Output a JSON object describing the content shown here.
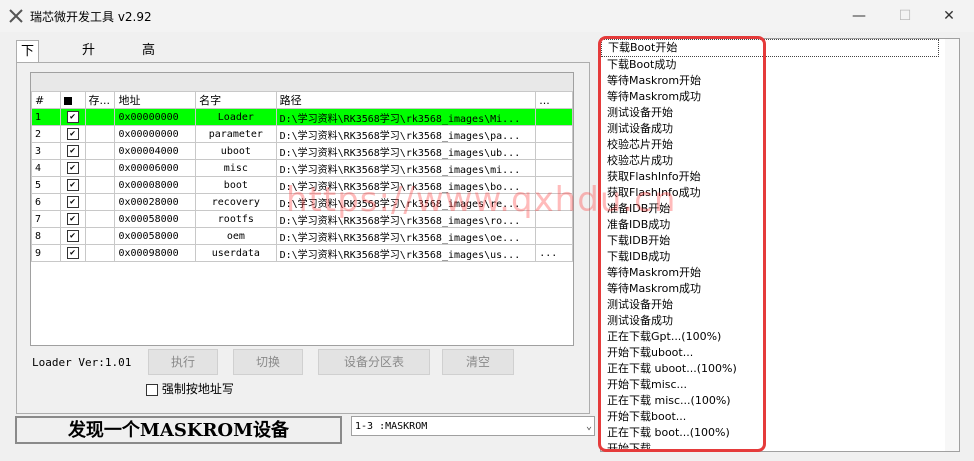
{
  "window": {
    "title": "瑞芯微开发工具 v2.92",
    "minimize": "—",
    "maximize": "☐",
    "close": "✕"
  },
  "tabs": [
    "下载镜像",
    "升级固件",
    "高级功能"
  ],
  "grid": {
    "headers": [
      "#",
      "",
      "存...",
      "地址",
      "名字",
      "路径",
      "..."
    ],
    "rows": [
      {
        "idx": "1",
        "checked": true,
        "addr": "0x00000000",
        "name": "Loader",
        "path": "D:\\学习资料\\RK3568学习\\rk3568_images\\Mi...",
        "more": "",
        "selected": true
      },
      {
        "idx": "2",
        "checked": true,
        "addr": "0x00000000",
        "name": "parameter",
        "path": "D:\\学习资料\\RK3568学习\\rk3568_images\\pa...",
        "more": ""
      },
      {
        "idx": "3",
        "checked": true,
        "addr": "0x00004000",
        "name": "uboot",
        "path": "D:\\学习资料\\RK3568学习\\rk3568_images\\ub...",
        "more": ""
      },
      {
        "idx": "4",
        "checked": true,
        "addr": "0x00006000",
        "name": "misc",
        "path": "D:\\学习资料\\RK3568学习\\rk3568_images\\mi...",
        "more": ""
      },
      {
        "idx": "5",
        "checked": true,
        "addr": "0x00008000",
        "name": "boot",
        "path": "D:\\学习资料\\RK3568学习\\rk3568_images\\bo...",
        "more": ""
      },
      {
        "idx": "6",
        "checked": true,
        "addr": "0x00028000",
        "name": "recovery",
        "path": "D:\\学习资料\\RK3568学习\\rk3568_images\\re...",
        "more": ""
      },
      {
        "idx": "7",
        "checked": true,
        "addr": "0x00058000",
        "name": "rootfs",
        "path": "D:\\学习资料\\RK3568学习\\rk3568_images\\ro...",
        "more": ""
      },
      {
        "idx": "8",
        "checked": true,
        "addr": "0x00058000",
        "name": "oem",
        "path": "D:\\学习资料\\RK3568学习\\rk3568_images\\oe...",
        "more": ""
      },
      {
        "idx": "9",
        "checked": true,
        "addr": "0x00098000",
        "name": "userdata",
        "path": "D:\\学习资料\\RK3568学习\\rk3568_images\\us...",
        "more": "..."
      }
    ]
  },
  "loader_version": "Loader Ver:1.01",
  "buttons": {
    "run": "执行",
    "switch": "切换",
    "partition": "设备分区表",
    "clear": "清空"
  },
  "force_addr_label": "强制按地址写",
  "status": "发现一个MASKROM设备",
  "device_select": "1-3 :MASKROM",
  "log": [
    "下载Boot开始",
    "下载Boot成功",
    "等待Maskrom开始",
    "等待Maskrom成功",
    "测试设备开始",
    "测试设备成功",
    "校验芯片开始",
    "校验芯片成功",
    "获取FlashInfo开始",
    "获取FlashInfo成功",
    "准备IDB开始",
    "准备IDB成功",
    "下载IDB开始",
    "下载IDB成功",
    "等待Maskrom开始",
    "等待Maskrom成功",
    "测试设备开始",
    "测试设备成功",
    "正在下载Gpt...(100%)",
    "开始下载uboot...",
    "正在下载 uboot...(100%)",
    "开始下载misc...",
    "正在下载 misc...(100%)",
    "开始下载boot...",
    "正在下载 boot...(100%)",
    "开始下载..."
  ],
  "watermark": "https://www.qxhdu.cn",
  "colors": {
    "selected_row": "#00ff00",
    "highlight_box": "#e53b3b"
  }
}
